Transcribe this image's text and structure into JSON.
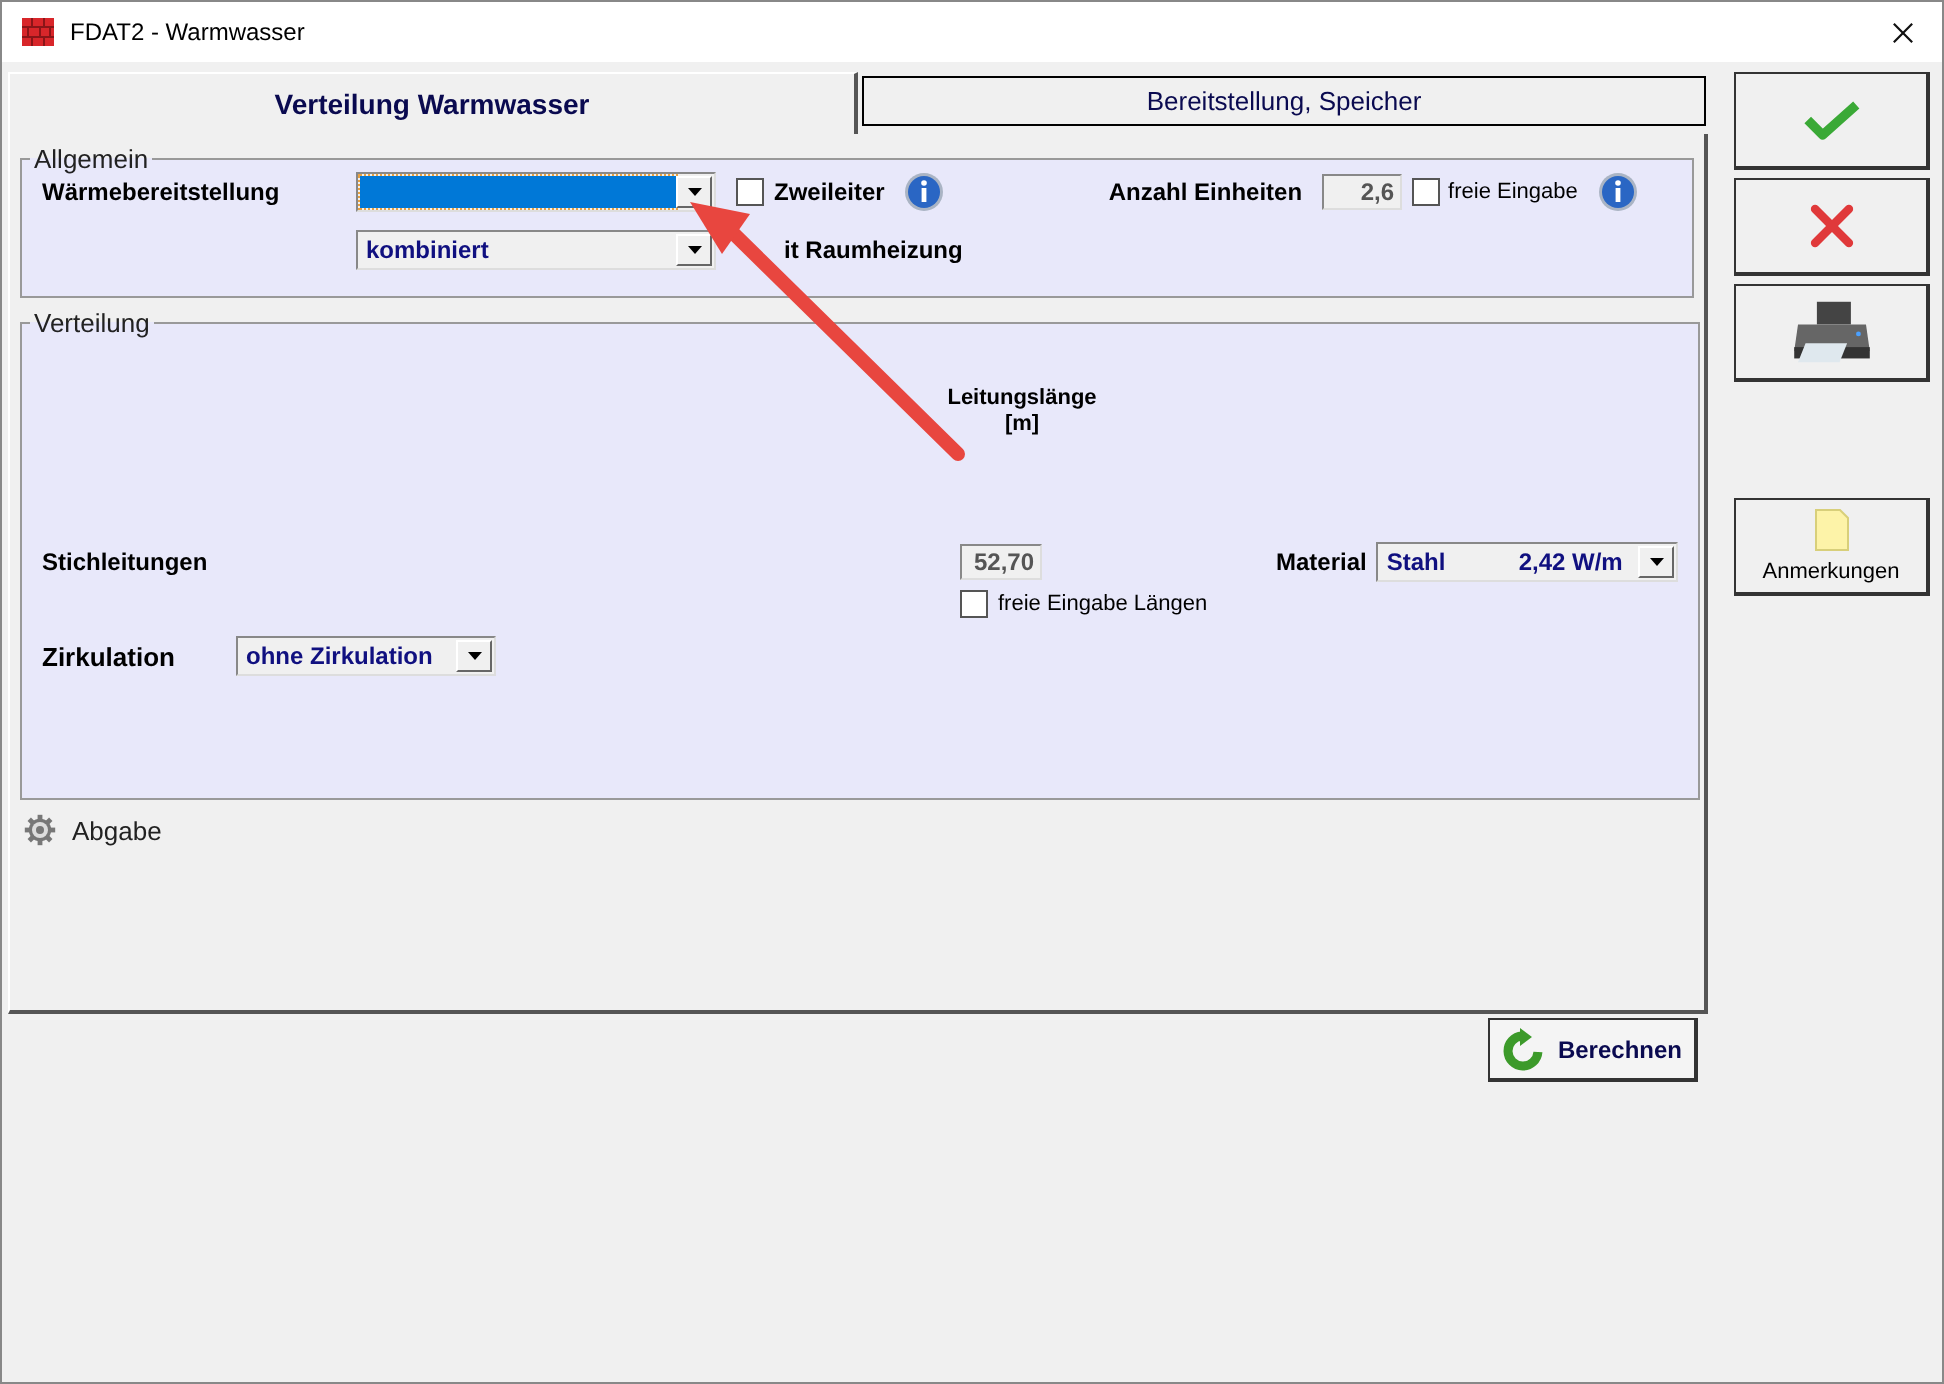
{
  "window": {
    "title": "FDAT2 - Warmwasser"
  },
  "tabs": [
    {
      "label": "Verteilung Warmwasser",
      "selected": true
    },
    {
      "label": "Bereitstellung, Speicher",
      "selected": false
    }
  ],
  "allgemein": {
    "title": "Allgemein",
    "waermebereitstellung": {
      "label": "Wärmebereitstellung",
      "focused": true
    },
    "zweileiter": {
      "label": "Zweileiter",
      "checked": false
    },
    "anzahl_einheiten": {
      "label": "Anzahl Einheiten",
      "value": "2,6"
    },
    "freie_eingabe": {
      "label": "freie Eingabe",
      "checked": false
    },
    "kombination": {
      "value": "kombiniert"
    },
    "raumheizung_label": "it Raumheizung"
  },
  "verteilung": {
    "title": "Verteilung",
    "column_header": "Leitungslänge\n[m]",
    "stichleitungen": {
      "label": "Stichleitungen",
      "length": "52,70",
      "material_label": "Material",
      "material": {
        "name": "Stahl",
        "value": "2,42 W/m"
      }
    },
    "freie_laengen": {
      "label": "freie Eingabe Längen",
      "checked": false
    },
    "zirkulation": {
      "label": "Zirkulation",
      "value": "ohne Zirkulation"
    }
  },
  "abgabe": {
    "label": "Abgabe"
  },
  "side_buttons": [
    {
      "kind": "ok"
    },
    {
      "kind": "cancel"
    },
    {
      "kind": "print"
    },
    {
      "kind": "notes",
      "label": "Anmerkungen"
    }
  ],
  "calc_button": {
    "label": "Berechnen"
  }
}
